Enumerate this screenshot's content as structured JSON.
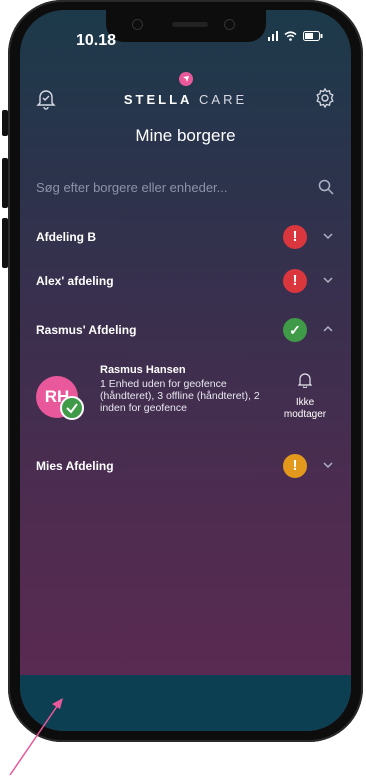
{
  "status_bar": {
    "time": "10.18"
  },
  "header": {
    "brand_bold": "STELLA",
    "brand_light": " CARE"
  },
  "page": {
    "title": "Mine borgere"
  },
  "search": {
    "placeholder": "Søg efter borgere eller enheder..."
  },
  "groups": [
    {
      "label": "Afdeling B",
      "status": "alert",
      "badge": "!",
      "color": "#d9363e",
      "expanded": false
    },
    {
      "label": "Alex' afdeling",
      "status": "alert",
      "badge": "!",
      "color": "#d9363e",
      "expanded": false
    },
    {
      "label": "Rasmus' Afdeling",
      "status": "ok",
      "badge": "✓",
      "color": "#3f9b47",
      "expanded": true
    },
    {
      "label": "Mies Afdeling",
      "status": "warning",
      "badge": "!",
      "color": "#e39a1c",
      "expanded": false
    }
  ],
  "person": {
    "initials": "RH",
    "name": "Rasmus Hansen",
    "description": "1 Enhed uden for geofence (håndteret), 3 offline (håndteret), 2 inden for geofence",
    "receiver_label": "Ikke modtager"
  },
  "colors": {
    "accent": "#e8589a",
    "bottom_bar": "#0d3f52"
  },
  "icons": [
    "bell-check-icon",
    "stella-logo-icon",
    "gear-icon",
    "search-icon",
    "chevron-down-icon",
    "chevron-up-icon",
    "bell-icon",
    "check-icon"
  ]
}
